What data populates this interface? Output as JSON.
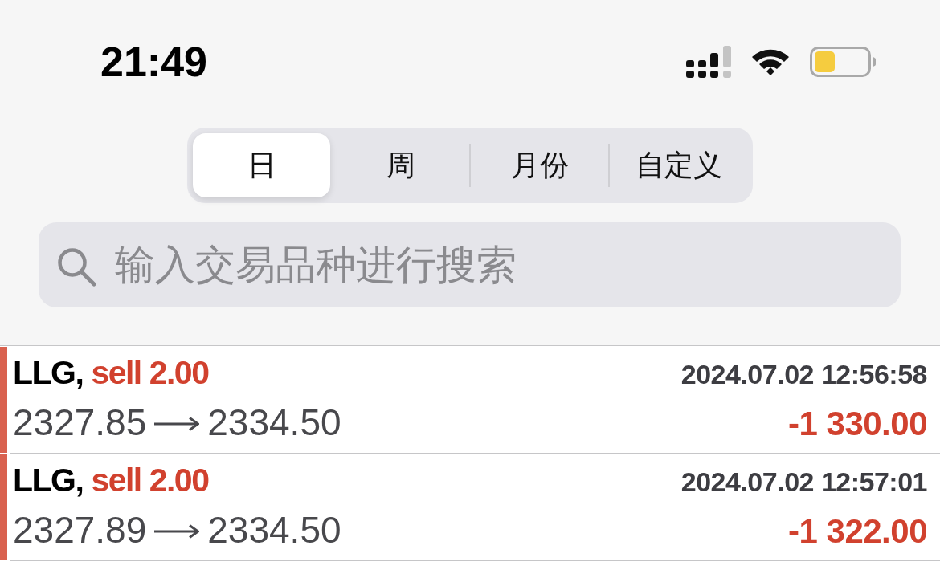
{
  "status_bar": {
    "time": "21:49"
  },
  "period_tabs": [
    {
      "label": "日",
      "selected": true
    },
    {
      "label": "周",
      "selected": false
    },
    {
      "label": "月份",
      "selected": false
    },
    {
      "label": "自定义",
      "selected": false
    }
  ],
  "search": {
    "placeholder": "输入交易品种进行搜索"
  },
  "deals": [
    {
      "symbol": "LLG,",
      "kind": "sell",
      "order": "sell 2.00",
      "time": "2024.07.02 12:56:58",
      "open_price": "2327.85",
      "close_price": "2334.50",
      "profit": "-1 330.00",
      "loss": true
    },
    {
      "symbol": "LLG,",
      "kind": "sell",
      "order": "sell 2.00",
      "time": "2024.07.02 12:57:01",
      "open_price": "2327.89",
      "close_price": "2334.50",
      "profit": "-1 322.00",
      "loss": true
    }
  ]
}
